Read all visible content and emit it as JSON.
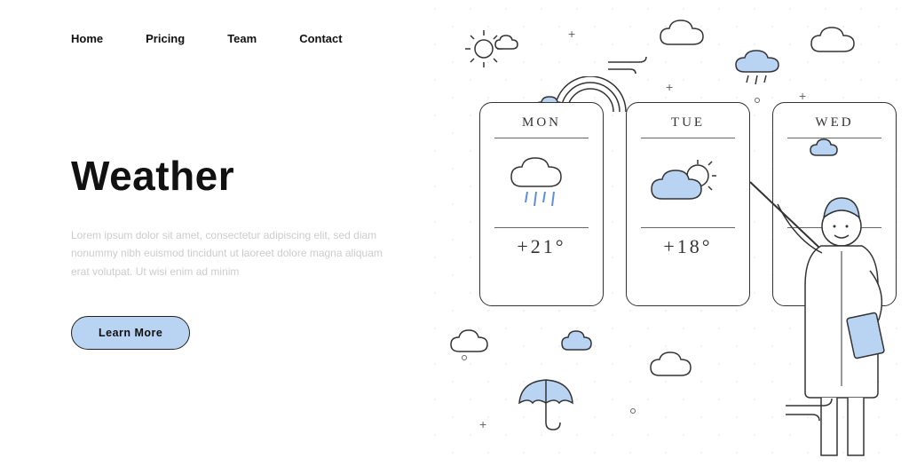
{
  "nav": {
    "home": "Home",
    "pricing": "Pricing",
    "team": "Team",
    "contact": "Contact"
  },
  "hero": {
    "headline": "Weather",
    "sub": "Lorem ipsum dolor sit amet, consectetur adipiscing elit, sed diam nonummy nibh euismod tincidunt ut laoreet dolore magna aliquam erat volutpat. Ut wisi enim ad minim",
    "cta": "Learn More"
  },
  "forecast": {
    "days": [
      {
        "name": "MON",
        "temp": "+21°",
        "icon": "rain"
      },
      {
        "name": "TUE",
        "temp": "+18°",
        "icon": "partly"
      },
      {
        "name": "WED",
        "temp": "",
        "icon": ""
      }
    ]
  },
  "colors": {
    "accent": "#b9d4f3"
  }
}
